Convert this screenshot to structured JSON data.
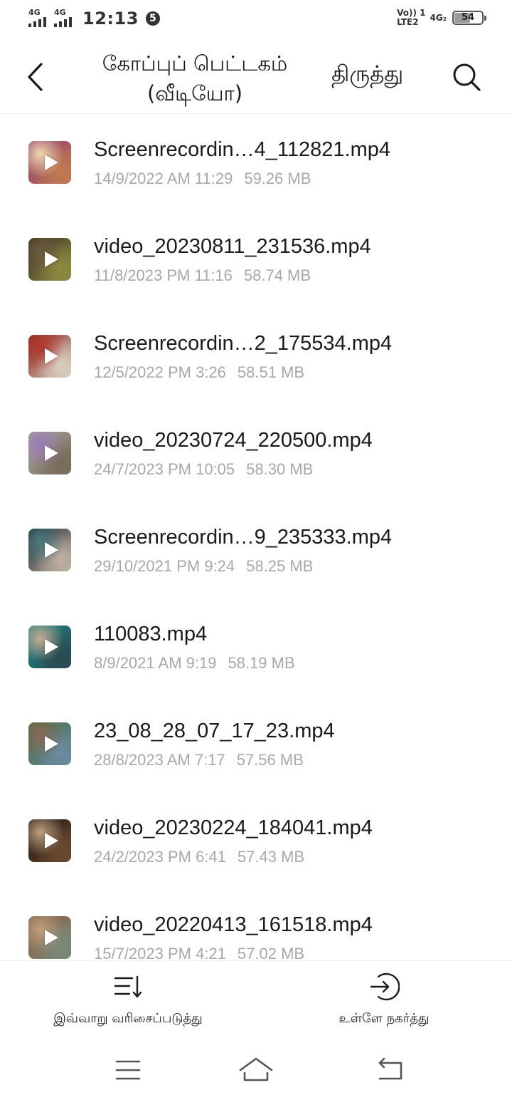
{
  "status_bar": {
    "sim1_net": "4G",
    "sim2_net": "4G",
    "time": "12:13",
    "notification_count": "5",
    "volte_line1": "Vo)) 1",
    "volte_line2": "LTE2",
    "net_right": "4G₂",
    "battery": "54",
    "battery_level": 0.54
  },
  "header": {
    "title_line1": "கோப்புப் பெட்டகம்",
    "title_line2": "(வீடியோ)",
    "edit_label": "திருத்து",
    "back_icon": "chevron-left-icon",
    "search_icon": "search-icon"
  },
  "files": [
    {
      "name": "Screenrecordin…4_112821.mp4",
      "date": "14/9/2022 AM 11:29",
      "size": "59.26 MB",
      "thumb_colors": [
        "#8b3a6b",
        "#f0d9b0",
        "#c07a50"
      ]
    },
    {
      "name": "video_20230811_231536.mp4",
      "date": "11/8/2023 PM 11:16",
      "size": "58.74 MB",
      "thumb_colors": [
        "#3a3026",
        "#6b5a3e",
        "#8e8a40"
      ]
    },
    {
      "name": "Screenrecordin…2_175534.mp4",
      "date": "12/5/2022 PM 3:26",
      "size": "58.51 MB",
      "thumb_colors": [
        "#8a1f1a",
        "#b03a2e",
        "#d9d0c0"
      ]
    },
    {
      "name": "video_20230724_220500.mp4",
      "date": "24/7/2023 PM 10:05",
      "size": "58.30 MB",
      "thumb_colors": [
        "#a8a8a0",
        "#9a7ab8",
        "#7a6a5a"
      ]
    },
    {
      "name": "Screenrecordin…9_235333.mp4",
      "date": "29/10/2021 PM 9:24",
      "size": "58.25 MB",
      "thumb_colors": [
        "#1a2a30",
        "#4a7a80",
        "#c0b0a0"
      ]
    },
    {
      "name": "110083.mp4",
      "date": "8/9/2021 AM 9:19",
      "size": "58.19 MB",
      "thumb_colors": [
        "#1a8a8a",
        "#c8a890",
        "#2a4a50"
      ]
    },
    {
      "name": "23_08_28_07_17_23.mp4",
      "date": "28/8/2023 AM 7:17",
      "size": "57.56 MB",
      "thumb_colors": [
        "#4a6a3a",
        "#8a6a5a",
        "#6a8aa0"
      ]
    },
    {
      "name": "video_20230224_184041.mp4",
      "date": "24/2/2023 PM 6:41",
      "size": "57.43 MB",
      "thumb_colors": [
        "#1a1410",
        "#c0a080",
        "#6a4a30"
      ]
    },
    {
      "name": "video_20220413_161518.mp4",
      "date": "15/7/2023 PM 4:21",
      "size": "57.02 MB",
      "thumb_colors": [
        "#8a5a40",
        "#c0a080",
        "#7a8a7a"
      ]
    }
  ],
  "action_bar": {
    "sort_label": "இவ்வாறு வரிசைப்படுத்து",
    "sort_icon": "sort-icon",
    "move_label": "உள்ளே நகர்த்து",
    "move_icon": "move-in-icon"
  },
  "nav_bar": {
    "menu_icon": "menu-icon",
    "home_icon": "home-icon",
    "back_icon": "back-icon"
  }
}
